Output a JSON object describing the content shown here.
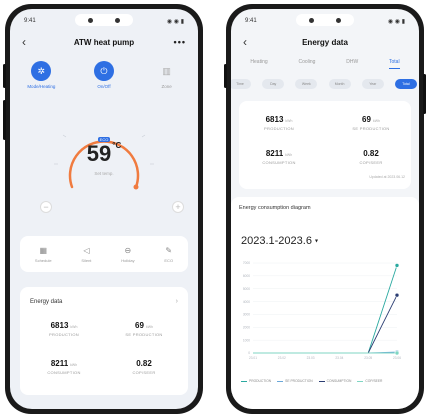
{
  "left": {
    "status": {
      "time": "9:41",
      "icons": "◉ ◉ ▮"
    },
    "title": "ATW heat pump",
    "modes": [
      {
        "label": "Mode/Heating",
        "active": true,
        "icon": "mode-icon"
      },
      {
        "label": "On/Off",
        "active": true,
        "icon": "power-icon"
      },
      {
        "label": "Zone",
        "active": false,
        "icon": "zone-icon"
      }
    ],
    "dial": {
      "badge": "ECO",
      "temp": "59",
      "unit": "°C",
      "sub": "Set temp."
    },
    "functions": [
      {
        "label": "Schedule",
        "icon": "schedule-icon"
      },
      {
        "label": "Silent",
        "icon": "silent-icon"
      },
      {
        "label": "Holiday",
        "icon": "holiday-icon"
      },
      {
        "label": "ECO",
        "icon": "eco-icon"
      }
    ],
    "energy": {
      "header": "Energy data",
      "production": {
        "value": "6813",
        "unit": "kWh",
        "label": "PRODUCTION"
      },
      "se_production": {
        "value": "69",
        "unit": "kWh",
        "label": "SE PRODUCTION"
      },
      "consumption": {
        "value": "8211",
        "unit": "kWh",
        "label": "CONSUMPTION"
      },
      "cop": {
        "value": "0.82",
        "label": "COP/SEER"
      }
    }
  },
  "right": {
    "status": {
      "time": "9:41",
      "icons": "◉ ◉ ▮"
    },
    "title": "Energy data",
    "tabs": [
      {
        "label": "Heating",
        "active": false
      },
      {
        "label": "Cooling",
        "active": false
      },
      {
        "label": "DHW",
        "active": false
      },
      {
        "label": "Total",
        "active": true
      }
    ],
    "periods": [
      {
        "label": "Time",
        "active": false
      },
      {
        "label": "Day",
        "active": false
      },
      {
        "label": "Week",
        "active": false
      },
      {
        "label": "Month",
        "active": false
      },
      {
        "label": "Year",
        "active": false
      },
      {
        "label": "Total",
        "active": true
      }
    ],
    "stats": {
      "production": {
        "value": "6813",
        "unit": "kWh",
        "label": "PRODUCTION"
      },
      "se_production": {
        "value": "69",
        "unit": "kWh",
        "label": "SE PRODUCTION"
      },
      "consumption": {
        "value": "8211",
        "unit": "kWh",
        "label": "CONSUMPTION"
      },
      "cop": {
        "value": "0.82",
        "label": "COP/SEER"
      },
      "updated": "Updated at 2023.06.12"
    },
    "chart_card": {
      "header": "Energy consumption diagram",
      "range": "2023.1-2023.6"
    },
    "legend": [
      {
        "label": "PRODUCTION",
        "color": "#2aa9a0"
      },
      {
        "label": "SE PRODUCTION",
        "color": "#6aa7d8"
      },
      {
        "label": "CONSUMPTION",
        "color": "#2c3e73"
      },
      {
        "label": "COP/SEER",
        "color": "#7fd6c3"
      }
    ]
  },
  "chart_data": {
    "type": "line",
    "categories": [
      "23.01",
      "23.02",
      "23.03",
      "23.04",
      "23.05",
      "23.06"
    ],
    "y_ticks": [
      "0",
      "1000",
      "2000",
      "3000",
      "4000",
      "5000",
      "6000",
      "7000"
    ],
    "ylim": [
      0,
      7000
    ],
    "series": [
      {
        "name": "PRODUCTION",
        "color": "#2aa9a0",
        "values": [
          0,
          0,
          0,
          0,
          0,
          6813
        ]
      },
      {
        "name": "SE PRODUCTION",
        "color": "#6aa7d8",
        "values": [
          0,
          0,
          0,
          0,
          0,
          69
        ]
      },
      {
        "name": "CONSUMPTION",
        "color": "#2c3e73",
        "values": [
          0,
          0,
          0,
          0,
          0,
          4500
        ]
      },
      {
        "name": "COP/SEER",
        "color": "#7fd6c3",
        "values": [
          0,
          0,
          0,
          0,
          0,
          0.82
        ]
      }
    ]
  }
}
